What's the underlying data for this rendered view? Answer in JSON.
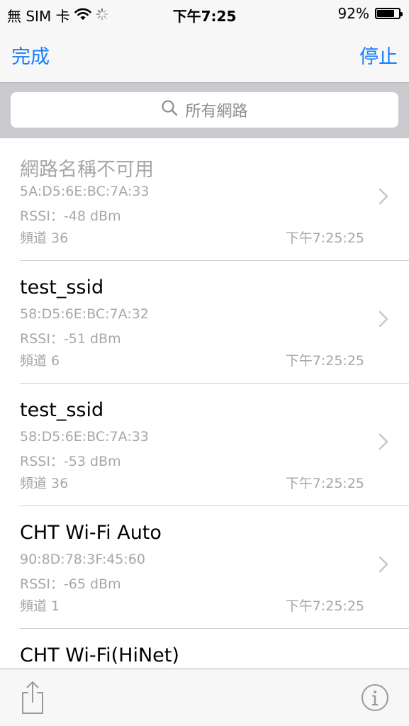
{
  "status_bar": {
    "carrier": "無 SIM 卡",
    "time": "下午7:25",
    "battery_percent": "92%",
    "battery_level": 0.92
  },
  "nav": {
    "done_label": "完成",
    "stop_label": "停止"
  },
  "search": {
    "placeholder": "所有網路"
  },
  "networks": [
    {
      "name": "網路名稱不可用",
      "mac": "5A:D5:6E:BC:7A:33",
      "rssi": "RSSI：-48 dBm",
      "channel": "頻道 36",
      "time": "下午7:25:25",
      "name_disabled": true
    },
    {
      "name": "test_ssid",
      "mac": "58:D5:6E:BC:7A:32",
      "rssi": "RSSI：-51 dBm",
      "channel": "頻道 6",
      "time": "下午7:25:25",
      "name_disabled": false
    },
    {
      "name": "test_ssid",
      "mac": "58:D5:6E:BC:7A:33",
      "rssi": "RSSI：-53 dBm",
      "channel": "頻道 36",
      "time": "下午7:25:25",
      "name_disabled": false
    },
    {
      "name": "CHT Wi-Fi Auto",
      "mac": "90:8D:78:3F:45:60",
      "rssi": "RSSI：-65 dBm",
      "channel": "頻道 1",
      "time": "下午7:25:25",
      "name_disabled": false
    },
    {
      "name": "CHT Wi-Fi(HiNet)",
      "mac": "",
      "rssi": "",
      "channel": "",
      "time": "",
      "name_disabled": false
    }
  ],
  "icons": {
    "wifi": "wifi-icon",
    "activity": "activity-spinner-icon",
    "search": "search-icon",
    "chevron": "chevron-right-icon",
    "share": "share-icon",
    "info": "info-icon"
  },
  "colors": {
    "accent": "#157efb",
    "secondary_text": "#a7a7ab",
    "bar_background": "#f7f7f7",
    "search_background": "#c9c9ce"
  }
}
